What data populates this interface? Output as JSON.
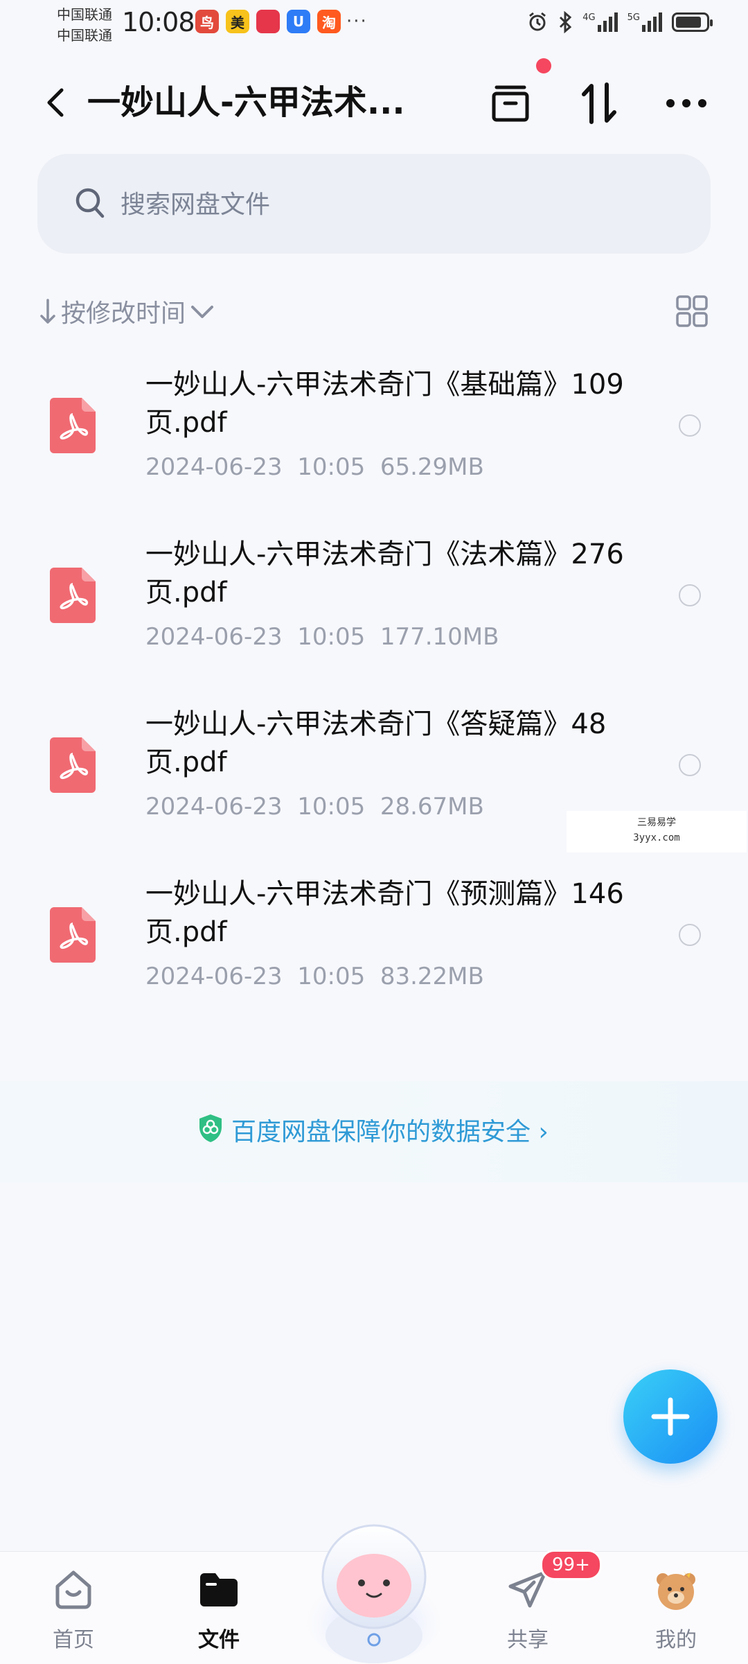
{
  "status_bar": {
    "carrier_1": "中国联通",
    "carrier_2": "中国联通",
    "time": "10:08",
    "app_icons": [
      {
        "name": "app-icon-1",
        "glyph": "鸟",
        "color": "#e24a3c"
      },
      {
        "name": "meituan-icon",
        "glyph": "美",
        "color": "#f7c21b"
      },
      {
        "name": "huawei-app-icon",
        "glyph": "",
        "color": "#e5364a"
      },
      {
        "name": "app-icon-blue",
        "glyph": "U",
        "color": "#2e7cf6"
      },
      {
        "name": "taobao-icon",
        "glyph": "淘",
        "color": "#ff5a1f"
      }
    ],
    "more": "···",
    "network_1": "4G",
    "network_2": "5G",
    "battery_level": 0.85
  },
  "header": {
    "title": "一妙山人-六甲法术...",
    "icons": [
      "back-icon",
      "archive-icon",
      "sort-transfer-icon",
      "more-icon"
    ]
  },
  "search": {
    "placeholder": "搜索网盘文件"
  },
  "sort": {
    "label": "按修改时间"
  },
  "files": [
    {
      "name": "一妙山人-六甲法术奇门《基础篇》109页.pdf",
      "date": "2024-06-23",
      "time": "10:05",
      "size": "65.29MB"
    },
    {
      "name": "一妙山人-六甲法术奇门《法术篇》276页.pdf",
      "date": "2024-06-23",
      "time": "10:05",
      "size": "177.10MB"
    },
    {
      "name": "一妙山人-六甲法术奇门《答疑篇》48页.pdf",
      "date": "2024-06-23",
      "time": "10:05",
      "size": "28.67MB"
    },
    {
      "name": "一妙山人-六甲法术奇门《预测篇》146页.pdf",
      "date": "2024-06-23",
      "time": "10:05",
      "size": "83.22MB"
    }
  ],
  "watermark": {
    "line1": "三易易学",
    "line2": "3yyx.com"
  },
  "security_banner": {
    "text": "百度网盘保障你的数据安全 ›"
  },
  "bottom_nav": {
    "items": [
      {
        "label": "首页"
      },
      {
        "label": "文件"
      },
      {
        "label": "共享"
      },
      {
        "label": "我的"
      }
    ],
    "share_badge": "99+"
  },
  "colors": {
    "accent": "#1a8ef5",
    "pdf": "#f06a72",
    "badge": "#f5475f",
    "security_text": "#2f9ad6"
  }
}
